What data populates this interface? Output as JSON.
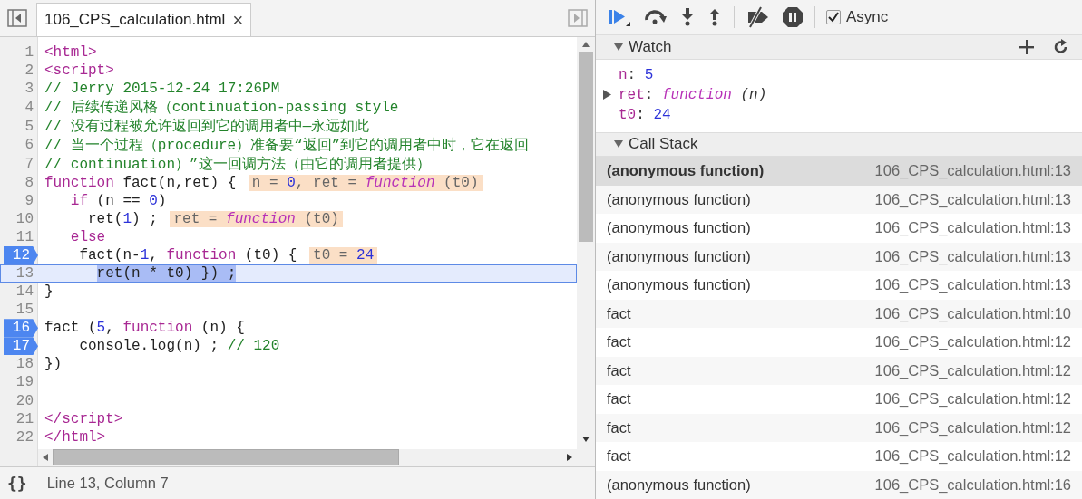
{
  "editor": {
    "tab": {
      "title": "106_CPS_calculation.html",
      "close": "×"
    },
    "lines": [
      {
        "number": "1",
        "breakpoint": false,
        "current": false,
        "tokens": [
          {
            "kind": "tag",
            "text": "<html>"
          }
        ]
      },
      {
        "number": "2",
        "breakpoint": false,
        "current": false,
        "tokens": [
          {
            "kind": "tag",
            "text": "<script>"
          }
        ]
      },
      {
        "number": "3",
        "breakpoint": false,
        "current": false,
        "tokens": [
          {
            "kind": "comment",
            "text": "// Jerry 2015-12-24 17:26PM"
          }
        ]
      },
      {
        "number": "4",
        "breakpoint": false,
        "current": false,
        "tokens": [
          {
            "kind": "comment",
            "text": "// 后续传递风格（continuation-passing style"
          }
        ]
      },
      {
        "number": "5",
        "breakpoint": false,
        "current": false,
        "tokens": [
          {
            "kind": "comment",
            "text": "// 没有过程被允许返回到它的调用者中—永远如此"
          }
        ]
      },
      {
        "number": "6",
        "breakpoint": false,
        "current": false,
        "tokens": [
          {
            "kind": "comment",
            "text": "// 当一个过程（procedure）准备要“返回”到它的调用者中时，它在返回"
          }
        ]
      },
      {
        "number": "7",
        "breakpoint": false,
        "current": false,
        "tokens": [
          {
            "kind": "comment",
            "text": "// continuation）”这一回调方法（由它的调用者提供）"
          }
        ]
      },
      {
        "number": "8",
        "breakpoint": false,
        "current": false,
        "tokens": [
          {
            "kind": "keyword",
            "text": "function"
          },
          {
            "kind": "plain",
            "text": " fact(n,ret) { "
          }
        ],
        "annotation": [
          {
            "kind": "plain",
            "text": "n = "
          },
          {
            "kind": "number",
            "text": "0"
          },
          {
            "kind": "plain",
            "text": ", ret = "
          },
          {
            "kind": "function",
            "text": "function"
          },
          {
            "kind": "plain",
            "text": " (t0)"
          }
        ]
      },
      {
        "number": "9",
        "breakpoint": false,
        "current": false,
        "tokens": [
          {
            "kind": "keyword",
            "text": "   if"
          },
          {
            "kind": "plain",
            "text": " (n == "
          },
          {
            "kind": "number",
            "text": "0"
          },
          {
            "kind": "plain",
            "text": ")"
          }
        ]
      },
      {
        "number": "10",
        "breakpoint": false,
        "current": false,
        "tokens": [
          {
            "kind": "plain",
            "text": "     ret("
          },
          {
            "kind": "number",
            "text": "1"
          },
          {
            "kind": "plain",
            "text": ") ; "
          }
        ],
        "annotation": [
          {
            "kind": "plain",
            "text": "ret = "
          },
          {
            "kind": "function",
            "text": "function"
          },
          {
            "kind": "plain",
            "text": " (t0)"
          }
        ]
      },
      {
        "number": "11",
        "breakpoint": false,
        "current": false,
        "tokens": [
          {
            "kind": "keyword",
            "text": "   else"
          }
        ]
      },
      {
        "number": "12",
        "breakpoint": true,
        "current": false,
        "tokens": [
          {
            "kind": "plain",
            "text": "    fact(n-"
          },
          {
            "kind": "number",
            "text": "1"
          },
          {
            "kind": "plain",
            "text": ", "
          },
          {
            "kind": "keyword",
            "text": "function"
          },
          {
            "kind": "plain",
            "text": " (t0) { "
          }
        ],
        "annotation": [
          {
            "kind": "plain",
            "text": "t0 = "
          },
          {
            "kind": "number",
            "text": "24"
          }
        ]
      },
      {
        "number": "13",
        "breakpoint": false,
        "current": true,
        "tokens": [
          {
            "kind": "selected",
            "text": "      ret(n * t0) }) ;"
          }
        ]
      },
      {
        "number": "14",
        "breakpoint": false,
        "current": false,
        "tokens": [
          {
            "kind": "plain",
            "text": "}"
          }
        ]
      },
      {
        "number": "15",
        "breakpoint": false,
        "current": false
      },
      {
        "number": "16",
        "breakpoint": true,
        "current": false,
        "tokens": [
          {
            "kind": "plain",
            "text": "fact ("
          },
          {
            "kind": "number",
            "text": "5"
          },
          {
            "kind": "plain",
            "text": ", "
          },
          {
            "kind": "keyword",
            "text": "function"
          },
          {
            "kind": "plain",
            "text": " (n) {"
          }
        ]
      },
      {
        "number": "17",
        "breakpoint": true,
        "current": false,
        "tokens": [
          {
            "kind": "plain",
            "text": "    console.log(n) ; "
          },
          {
            "kind": "comment",
            "text": "// 120"
          }
        ]
      },
      {
        "number": "18",
        "breakpoint": false,
        "current": false,
        "tokens": [
          {
            "kind": "plain",
            "text": "})"
          }
        ]
      },
      {
        "number": "19",
        "breakpoint": false,
        "current": false
      },
      {
        "number": "20",
        "breakpoint": false,
        "current": false
      },
      {
        "number": "21",
        "breakpoint": false,
        "current": false,
        "tokens": [
          {
            "kind": "tag",
            "text": "</script>"
          }
        ]
      },
      {
        "number": "22",
        "breakpoint": false,
        "current": false,
        "tokens": [
          {
            "kind": "tag",
            "text": "</html>"
          }
        ]
      }
    ],
    "status": {
      "format": "{}",
      "position": "Line 13, Column 7"
    }
  },
  "debugger": {
    "async": {
      "label": "Async",
      "checked": true
    },
    "watch": {
      "title": "Watch",
      "expanded": true,
      "items": [
        {
          "name": "n",
          "separator": ":",
          "kind": "number",
          "value": "5",
          "expandable": false
        },
        {
          "name": "ret",
          "separator": ":",
          "kind": "function",
          "value": "function",
          "args": "(n)",
          "expandable": true
        },
        {
          "name": "t0",
          "separator": ":",
          "kind": "number",
          "value": "24",
          "expandable": false
        }
      ]
    },
    "call_stack": {
      "title": "Call Stack",
      "expanded": true,
      "frames": [
        {
          "name": "(anonymous function)",
          "location": "106_CPS_calculation.html:13",
          "selected": true
        },
        {
          "name": "(anonymous function)",
          "location": "106_CPS_calculation.html:13",
          "selected": false
        },
        {
          "name": "(anonymous function)",
          "location": "106_CPS_calculation.html:13",
          "selected": false
        },
        {
          "name": "(anonymous function)",
          "location": "106_CPS_calculation.html:13",
          "selected": false
        },
        {
          "name": "(anonymous function)",
          "location": "106_CPS_calculation.html:13",
          "selected": false
        },
        {
          "name": "fact",
          "location": "106_CPS_calculation.html:10",
          "selected": false
        },
        {
          "name": "fact",
          "location": "106_CPS_calculation.html:12",
          "selected": false
        },
        {
          "name": "fact",
          "location": "106_CPS_calculation.html:12",
          "selected": false
        },
        {
          "name": "fact",
          "location": "106_CPS_calculation.html:12",
          "selected": false
        },
        {
          "name": "fact",
          "location": "106_CPS_calculation.html:12",
          "selected": false
        },
        {
          "name": "fact",
          "location": "106_CPS_calculation.html:12",
          "selected": false
        },
        {
          "name": "(anonymous function)",
          "location": "106_CPS_calculation.html:16",
          "selected": false
        }
      ]
    }
  }
}
